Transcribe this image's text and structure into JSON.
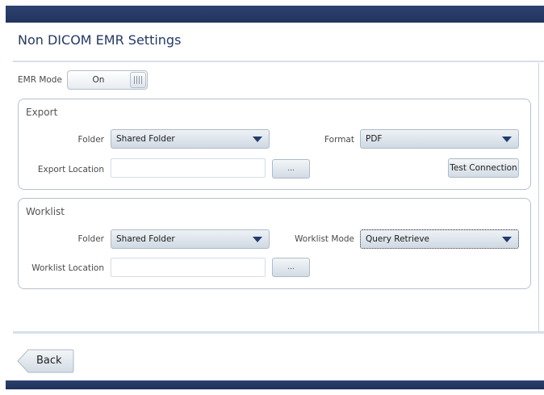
{
  "page": {
    "title": "Non DICOM EMR Settings"
  },
  "emr_mode": {
    "label": "EMR Mode",
    "value": "On"
  },
  "export": {
    "title": "Export",
    "folder_label": "Folder",
    "folder_value": "Shared Folder",
    "format_label": "Format",
    "format_value": "PDF",
    "location_label": "Export Location",
    "location_value": "",
    "browse_label": "...",
    "test_label": "Test Connection"
  },
  "worklist": {
    "title": "Worklist",
    "folder_label": "Folder",
    "folder_value": "Shared Folder",
    "mode_label": "Worklist Mode",
    "mode_value": "Query Retrieve",
    "location_label": "Worklist Location",
    "location_value": "",
    "browse_label": "..."
  },
  "footer": {
    "back_label": "Back"
  },
  "icons": {
    "caret": "chevron-down-icon",
    "toggle_grip": "grip-icon",
    "back_arrow": "arrow-left-icon"
  },
  "colors": {
    "title": "#243a66",
    "header_bar": "#22345d",
    "caret": "#233b6a"
  }
}
